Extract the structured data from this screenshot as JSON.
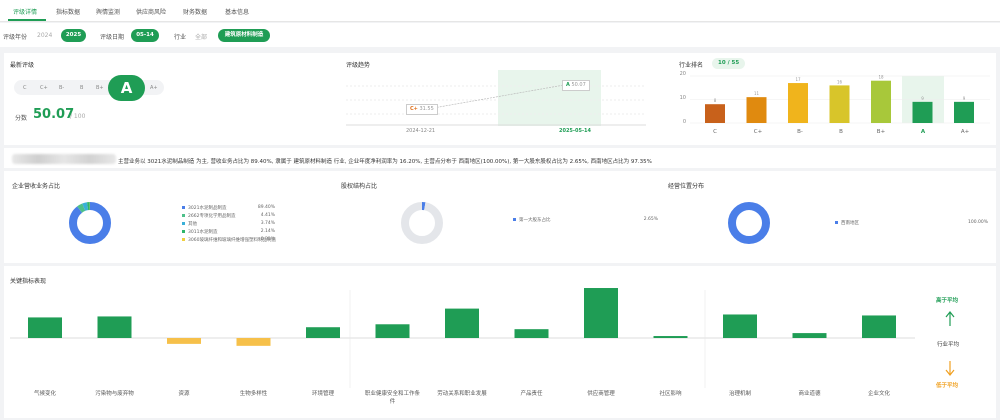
{
  "tabs": [
    "评级详情",
    "指标数据",
    "舆情监测",
    "供应商风险",
    "财务数据",
    "基本信息"
  ],
  "filters": {
    "year_label": "评级年份",
    "year_prev": "2024",
    "year_current": "2025",
    "date_label": "评级日期",
    "date_value": "05-14",
    "industry_label": "行业",
    "industry_all": "全部",
    "industry_value": "建筑原材料制造"
  },
  "rating": {
    "title": "最新评级",
    "grades": [
      "C",
      "C+",
      "B-",
      "B",
      "B+",
      "A",
      "A+"
    ],
    "current": "A",
    "score_label": "分数",
    "score": "50.07",
    "score_total": "/ 100"
  },
  "trend": {
    "title": "评级趋势",
    "dates": [
      "2024-12-21",
      "2025-05-14"
    ],
    "points": [
      {
        "grade": "C+",
        "score": "31.55"
      },
      {
        "grade": "A",
        "score": "50.07"
      }
    ]
  },
  "rank": {
    "title": "行业排名",
    "badge": "10 / 55",
    "y_ticks": [
      "20",
      "10",
      "0"
    ],
    "chart_data": {
      "type": "bar",
      "categories": [
        "C",
        "C+",
        "B-",
        "B",
        "B+",
        "A",
        "A+"
      ],
      "values": [
        8,
        11,
        17,
        16,
        18,
        9,
        9
      ],
      "ylim": [
        0,
        20
      ],
      "highlight": "A",
      "colors": [
        "#c8611b",
        "#e08a0f",
        "#f0b41c",
        "#d8c52a",
        "#a8c83a",
        "#1f9d55",
        "#1f9d55"
      ]
    }
  },
  "summary": {
    "text": "主营业务以 3021水泥制品制造 为主, 营收业务占比为 89.40%, 隶属于 建筑原材料制造 行业, 企业年度净利润率为 16.20%, 主营点分布于 西南地区(100.00%), 第一大股东股权占比为 2.65%, 西南地区占比为 97.35%"
  },
  "donuts": [
    {
      "title": "企业营收业务占比",
      "chart_data": {
        "type": "pie",
        "labels": [
          "3021水泥制品制造",
          "2662专项化学用品制造",
          "其他",
          "3011水泥制造",
          "3060玻璃纤维和玻璃纤维增强塑料制品制造"
        ],
        "values": [
          89.4,
          4.41,
          3.74,
          2.14,
          0.31
        ],
        "value_labels": [
          "89.40%",
          "4.41%",
          "3.74%",
          "2.14%",
          "0.31%"
        ],
        "colors": [
          "#4a7ee8",
          "#4dc08a",
          "#3ab0d8",
          "#2fb56a",
          "#f0d040"
        ]
      }
    },
    {
      "title": "股权结构占比",
      "chart_data": {
        "type": "pie",
        "labels": [
          "第一大股东占比",
          "其他"
        ],
        "values": [
          2.65,
          97.35
        ],
        "value_labels": [
          "2.65%"
        ],
        "colors": [
          "#4a7ee8",
          "#e4e6ea"
        ]
      }
    },
    {
      "title": "经营位置分布",
      "chart_data": {
        "type": "pie",
        "labels": [
          "西南地区"
        ],
        "values": [
          100.0
        ],
        "value_labels": [
          "100.00%"
        ],
        "colors": [
          "#4a7ee8"
        ]
      }
    }
  ],
  "indicators": {
    "title": "关键指标表现",
    "side_high": "高于平均",
    "side_avg": "行业平均",
    "side_low": "低于平均",
    "chart_data": {
      "type": "bar",
      "categories": [
        "气候变化",
        "污染物与废弃物",
        "资源",
        "生物多样性",
        "环境管理",
        "职业健康安全和工作条件",
        "劳动关系和职业发展",
        "产品责任",
        "供应商管理",
        "社区影响",
        "治理机制",
        "商业道德",
        "企业文化"
      ],
      "values": [
        21,
        22,
        -6,
        -8,
        11,
        14,
        30,
        9,
        51,
        2,
        24,
        5,
        23
      ],
      "baseline": "行业平均"
    }
  }
}
